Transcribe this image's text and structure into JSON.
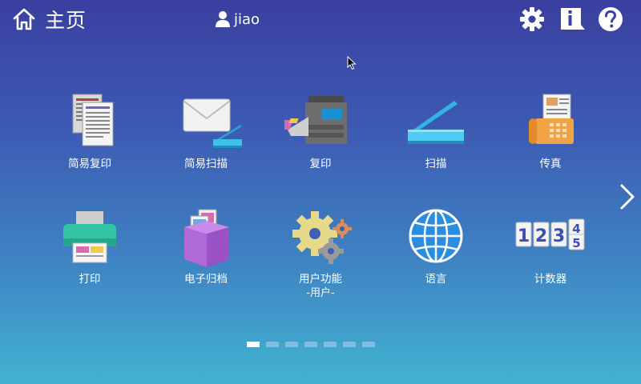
{
  "header": {
    "title": "主页",
    "user": "jiao",
    "icons": [
      "home-icon",
      "user-icon",
      "gear-icon",
      "info-icon",
      "help-icon"
    ]
  },
  "apps": [
    {
      "label": "简易复印",
      "sub": "",
      "icon": "easy-copy-icon"
    },
    {
      "label": "简易扫描",
      "sub": "",
      "icon": "easy-scan-icon"
    },
    {
      "label": "复印",
      "sub": "",
      "icon": "copier-icon"
    },
    {
      "label": "扫描",
      "sub": "",
      "icon": "scanner-icon"
    },
    {
      "label": "传真",
      "sub": "",
      "icon": "fax-icon"
    },
    {
      "label": "打印",
      "sub": "",
      "icon": "printer-icon"
    },
    {
      "label": "电子归档",
      "sub": "",
      "icon": "document-box-icon"
    },
    {
      "label": "用户功能",
      "sub": "-用户-",
      "icon": "gears-icon"
    },
    {
      "label": "语言",
      "sub": "",
      "icon": "globe-icon"
    },
    {
      "label": "计数器",
      "sub": "",
      "icon": "counter-icon"
    }
  ],
  "pager": {
    "pages": 7,
    "current": 1
  },
  "colors": {
    "bg_top": "#3a3fa0",
    "bg_bottom": "#41b3d0"
  }
}
